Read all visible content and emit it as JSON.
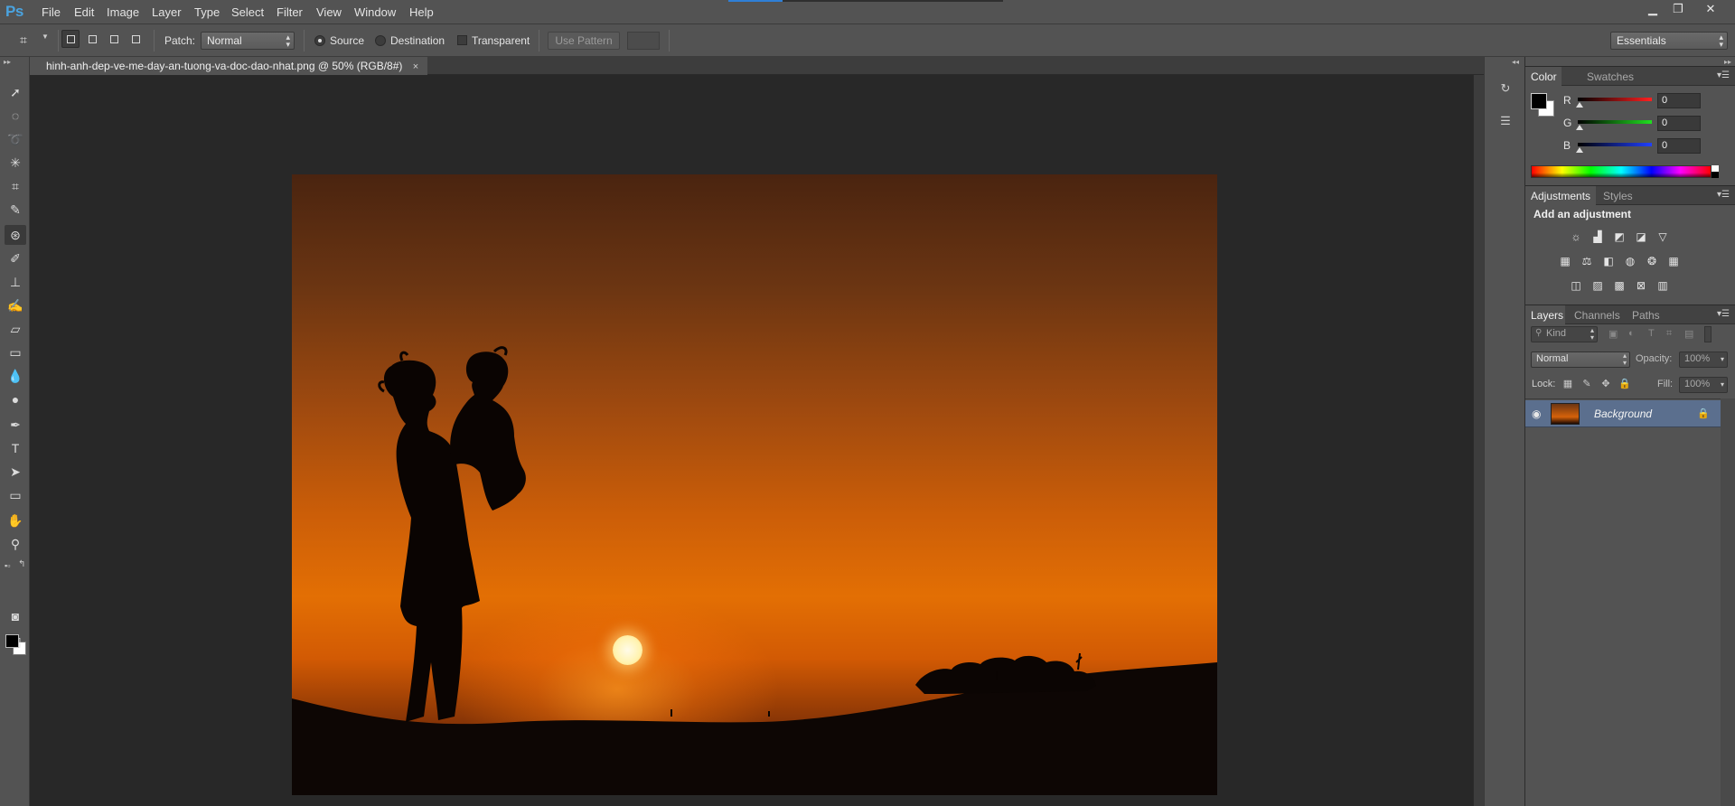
{
  "app": {
    "logo": "Ps"
  },
  "menu": [
    "File",
    "Edit",
    "Image",
    "Layer",
    "Type",
    "Select",
    "Filter",
    "View",
    "Window",
    "Help"
  ],
  "window_controls": {
    "minimize": "▁",
    "restore": "❐",
    "close": "✕"
  },
  "options_bar": {
    "patch_label": "Patch:",
    "patch_mode": "Normal",
    "source_label": "Source",
    "destination_label": "Destination",
    "transparent_label": "Transparent",
    "use_pattern_label": "Use Pattern",
    "workspace": "Essentials"
  },
  "document": {
    "tab_title": "hinh-anh-dep-ve-me-day-an-tuong-va-doc-dao-nhat.png @ 50% (RGB/8#)",
    "close": "×"
  },
  "color_panel": {
    "tabs": [
      "Color",
      "Swatches"
    ],
    "channels": [
      {
        "label": "R",
        "value": "0",
        "color": "#d42020"
      },
      {
        "label": "G",
        "value": "0",
        "color": "#1fb021"
      },
      {
        "label": "B",
        "value": "0",
        "color": "#2230d0"
      }
    ]
  },
  "adjustments_panel": {
    "tabs": [
      "Adjustments",
      "Styles"
    ],
    "heading": "Add an adjustment",
    "icons_row1": [
      "brightness-icon",
      "levels-icon",
      "curves-icon",
      "exposure-icon",
      "vibrance-icon"
    ],
    "icons_row2": [
      "hue-saturation-icon",
      "color-balance-icon",
      "black-white-icon",
      "photo-filter-icon",
      "channel-mixer-icon",
      "color-lookup-icon"
    ],
    "icons_row3": [
      "invert-icon",
      "posterize-icon",
      "threshold-icon",
      "selective-color-icon",
      "gradient-map-icon"
    ]
  },
  "layers_panel": {
    "tabs": [
      "Layers",
      "Channels",
      "Paths"
    ],
    "kind_label": "Kind",
    "blend_mode": "Normal",
    "opacity_label": "Opacity:",
    "opacity_value": "100%",
    "lock_label": "Lock:",
    "fill_label": "Fill:",
    "fill_value": "100%",
    "layers": [
      {
        "name": "Background",
        "locked": true,
        "visible": true
      }
    ]
  },
  "colors": {
    "accent_blue": "#2f7fd6",
    "selection_row": "#5b6f8e"
  }
}
